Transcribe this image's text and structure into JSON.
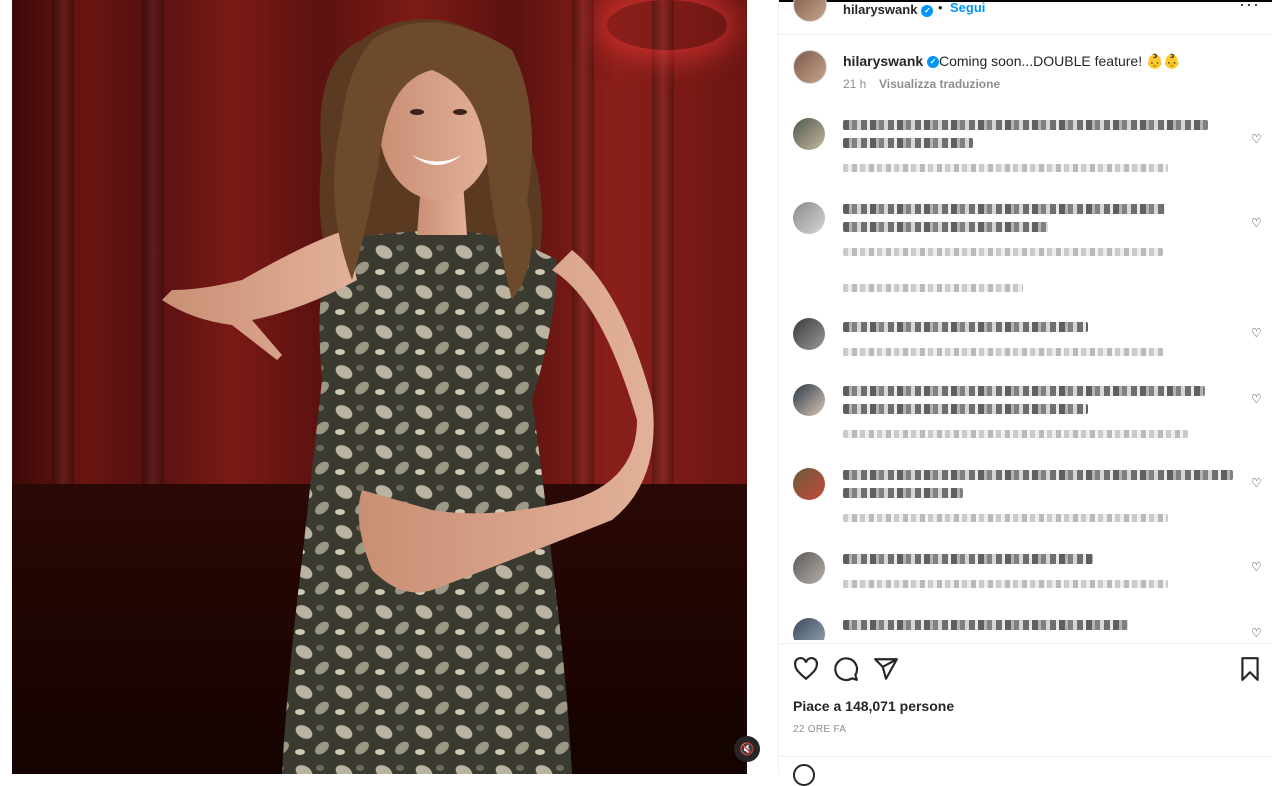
{
  "post": {
    "username": "hilaryswank",
    "follow_label": "Segui",
    "separator": "•",
    "more_label": "···",
    "caption_text": "Coming soon...DOUBLE feature! 👶👶",
    "caption_time": "21 h",
    "translate_label": "Visualizza traduzione",
    "likes_text": "Piace a 148,071 persone",
    "posted_ago": "22 ORE FA"
  },
  "comments": [
    {
      "id": 1,
      "blurred": true,
      "has_reply_link": false
    },
    {
      "id": 2,
      "blurred": true,
      "has_reply_link": true
    },
    {
      "id": 3,
      "blurred": true,
      "has_reply_link": false
    },
    {
      "id": 4,
      "blurred": true,
      "has_reply_link": false
    },
    {
      "id": 5,
      "blurred": true,
      "has_reply_link": false
    },
    {
      "id": 6,
      "blurred": true,
      "has_reply_link": false
    },
    {
      "id": 7,
      "blurred": true,
      "has_reply_link": false
    }
  ],
  "icons": {
    "like": "heart-icon",
    "comment": "comment-icon",
    "share": "share-icon",
    "save": "bookmark-icon",
    "mute": "mute-icon",
    "verified": "verified-badge-icon"
  },
  "colors": {
    "accent": "#0095f6",
    "text": "#262626",
    "secondary": "#8e8e8e"
  }
}
